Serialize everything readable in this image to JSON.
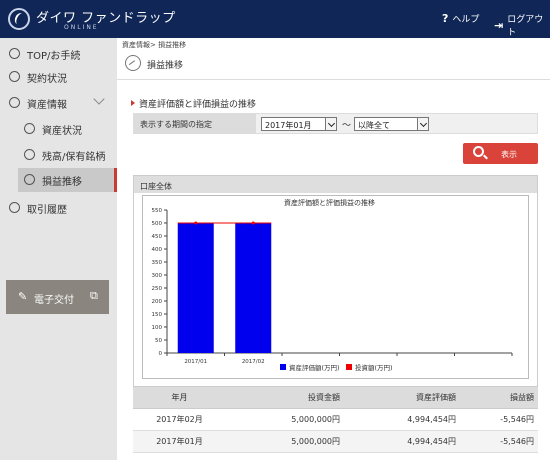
{
  "header": {
    "brand": "ダイワ ファンドラップ",
    "brand_sub": "ONLINE",
    "help": "ヘルプ",
    "logout": "ログアウト",
    "help_icon": "question-icon",
    "logout_icon": "logout-icon"
  },
  "sidebar": {
    "items": [
      {
        "label": "TOP/お手続",
        "icon": "home-icon"
      },
      {
        "label": "契約状況",
        "icon": "contract-icon"
      },
      {
        "label": "資産情報",
        "icon": "asset-icon"
      },
      {
        "label": "資産状況",
        "icon": "asset-status-icon"
      },
      {
        "label": "残高/保有銘柄",
        "icon": "balance-icon"
      },
      {
        "label": "損益推移",
        "icon": "trend-icon"
      },
      {
        "label": "取引履歴",
        "icon": "history-icon"
      }
    ],
    "ebook": "電子交付"
  },
  "breadcrumb": "資産情報> 損益推移",
  "page_title": "損益推移",
  "section_title": "資産評価額と評価損益の推移",
  "period": {
    "label": "表示する期間の指定",
    "from": "2017年01月",
    "separator": "〜",
    "to": "以降全て"
  },
  "show_button": "表示",
  "panel_title": "口座全体",
  "accent_color": "#d9433a",
  "chart_data": {
    "type": "bar",
    "title": "資産評価額と評価損益の推移",
    "categories": [
      "2017/01",
      "2017/02"
    ],
    "series": [
      {
        "name": "資産評価額(万円)",
        "type": "bar",
        "color": "#0000ee",
        "values": [
          499.4,
          499.4
        ]
      },
      {
        "name": "投資額(万円)",
        "type": "line",
        "color": "#ee0000",
        "values": [
          500,
          500
        ]
      }
    ],
    "ylim": [
      0,
      550
    ],
    "yticks": [
      0,
      50,
      100,
      150,
      200,
      250,
      300,
      350,
      400,
      450,
      500,
      550
    ],
    "grid": false,
    "legend": "bottom"
  },
  "table": {
    "headers": [
      "年月",
      "投資金額",
      "資産評価額",
      "損益額"
    ],
    "rows": [
      [
        "2017年02月",
        "5,000,000円",
        "4,994,454円",
        "-5,546円"
      ],
      [
        "2017年01月",
        "5,000,000円",
        "4,994,454円",
        "-5,546円"
      ]
    ]
  }
}
